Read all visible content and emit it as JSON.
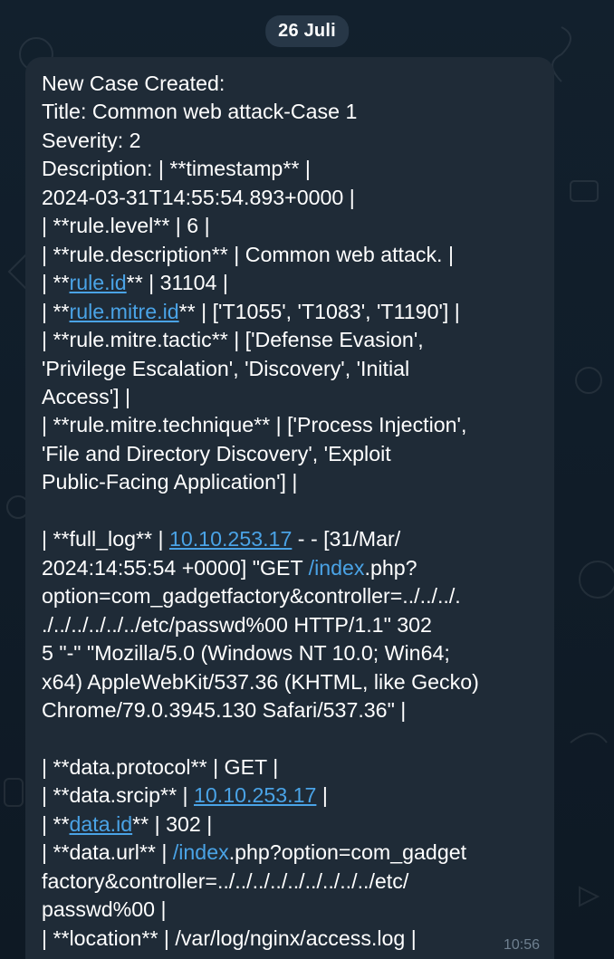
{
  "date_chip": "26 Juli",
  "message": {
    "header": "New Case Created:",
    "title_line": "Title: Common web attack-Case 1",
    "severity_line": "Severity: 2",
    "description_start": "Description: | **timestamp** |",
    "timestamp_value": "2024-03-31T14:55:54.893+0000 |",
    "rule_level": "| **rule.level** | 6 |",
    "rule_description": "| **rule.description** | Common web attack. |",
    "rule_id_prefix": "| **",
    "rule_id_link": "rule.id",
    "rule_id_suffix": "** | 31104 |",
    "mitre_id_prefix": "| **",
    "mitre_id_link": "rule.mitre.id",
    "mitre_id_suffix": "** | ['T1055', 'T1083', 'T1190'] |",
    "mitre_tactic_1": "| **rule.mitre.tactic** | ['Defense Evasion',",
    "mitre_tactic_2": "'Privilege Escalation', 'Discovery', 'Initial",
    "mitre_tactic_3": "Access'] |",
    "mitre_technique_1": "| **rule.mitre.technique** | ['Process Injection',",
    "mitre_technique_2": "'File and Directory Discovery', 'Exploit",
    "mitre_technique_3": "Public-Facing Application'] |",
    "full_log_prefix": "| **full_log** | ",
    "full_log_ip": "10.10.253.17",
    "full_log_after_ip": " - - [31/Mar/",
    "full_log_2_before": "2024:14:55:54 +0000] \"GET ",
    "full_log_2_path": "/index",
    "full_log_2_after": ".php?",
    "full_log_3": "option=com_gadgetfactory&controller=../../../.",
    "full_log_4": "./../../../../../etc/passwd%00 HTTP/1.1\" 302",
    "full_log_5": "5 \"-\" \"Mozilla/5.0 (Windows NT 10.0; Win64;",
    "full_log_6": "x64) AppleWebKit/537.36 (KHTML, like Gecko)",
    "full_log_7": "Chrome/79.0.3945.130 Safari/537.36\" |",
    "data_protocol": "| **data.protocol** | GET |",
    "data_srcip_prefix": "| **data.srcip** | ",
    "data_srcip_link": "10.10.253.17",
    "data_srcip_suffix": " |",
    "data_id_prefix": "| **",
    "data_id_link": "data.id",
    "data_id_suffix": "** | 302 |",
    "data_url_prefix": "| **data.url** | ",
    "data_url_path": "/index",
    "data_url_after": ".php?option=com_gadget",
    "data_url_2": "factory&controller=../../../../../../../../../etc/",
    "data_url_3": "passwd%00 |",
    "location_line": "| **location** | /var/log/nginx/access.log |",
    "time": "10:56"
  }
}
